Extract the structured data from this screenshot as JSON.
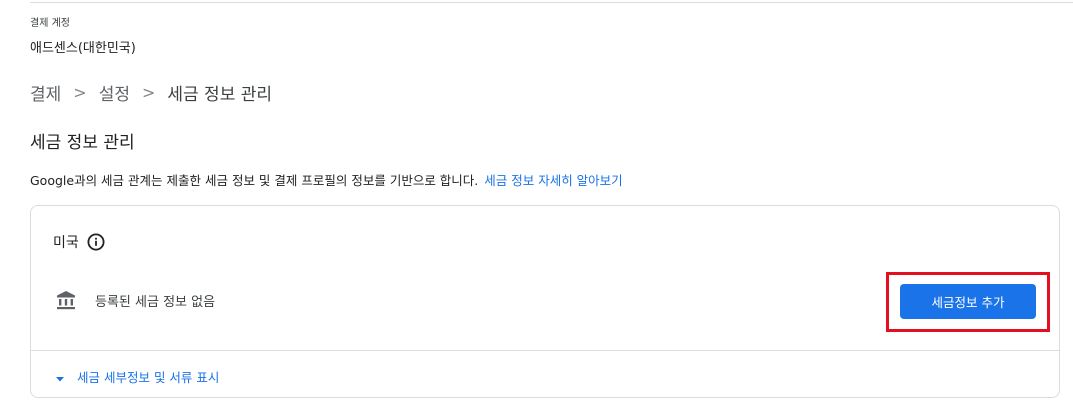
{
  "account": {
    "label": "결제 계정",
    "name": "애드센스(대한민국)"
  },
  "breadcrumb": {
    "items": [
      "결제",
      "설정",
      "세금 정보 관리"
    ],
    "separator": ">"
  },
  "page": {
    "title": "세금 정보 관리",
    "description": "Google과의 세금 관계는 제출한 세금 정보 및 결제 프로필의 정보를 기반으로 합니다.",
    "learn_more_link": "세금 정보 자세히 알아보기"
  },
  "tax_card": {
    "country": "미국",
    "info_icon": "info-icon",
    "bank_icon": "bank-icon",
    "status_text": "등록된 세금 정보 없음",
    "add_button_label": "세금정보 추가",
    "details_toggle_label": "세금 세부정보 및 서류 표시",
    "caret_icon": "caret-down-icon"
  },
  "colors": {
    "accent": "#1a73e8",
    "highlight": "#e3101f",
    "border": "#dadce0",
    "text": "#202124",
    "muted": "#5f6368"
  }
}
